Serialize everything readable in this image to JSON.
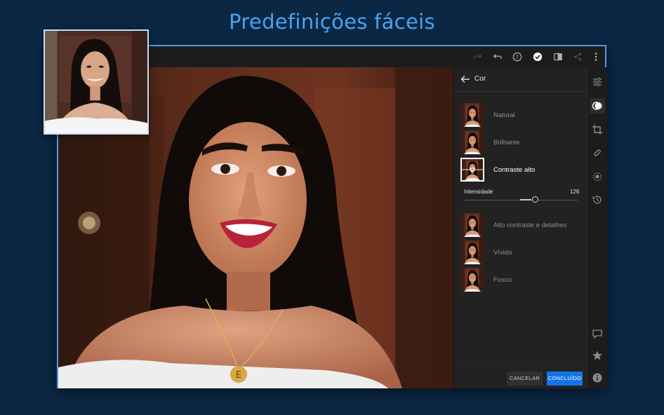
{
  "headline": "Predefinições fáceis",
  "panel": {
    "title": "Cor",
    "presets": [
      {
        "label": "Natural",
        "selected": false
      },
      {
        "label": "Brilhante",
        "selected": false
      },
      {
        "label": "Contraste alto",
        "selected": true
      },
      {
        "label": "Alto contraste e detalhes",
        "selected": false
      },
      {
        "label": "Vívido",
        "selected": false
      },
      {
        "label": "Fosco",
        "selected": false
      }
    ],
    "intensity": {
      "label": "Intensidade",
      "value": "126"
    },
    "cancel_label": "CANCELAR",
    "done_label": "CONCLUÍDO"
  },
  "topbar_icons": [
    "redo-icon",
    "undo-icon",
    "help-icon",
    "checkmark-icon",
    "compare-icon",
    "share-icon",
    "more-icon"
  ],
  "rail_icons": [
    "sliders-icon",
    "presets-icon",
    "crop-icon",
    "healing-brush-icon",
    "selective-icon",
    "history-icon",
    "comment-icon",
    "star-icon",
    "info-icon"
  ],
  "colors": {
    "accent": "#1473e6",
    "headline": "#4aa3f0",
    "frame": "#4f9de9",
    "background": "#0b2744"
  }
}
